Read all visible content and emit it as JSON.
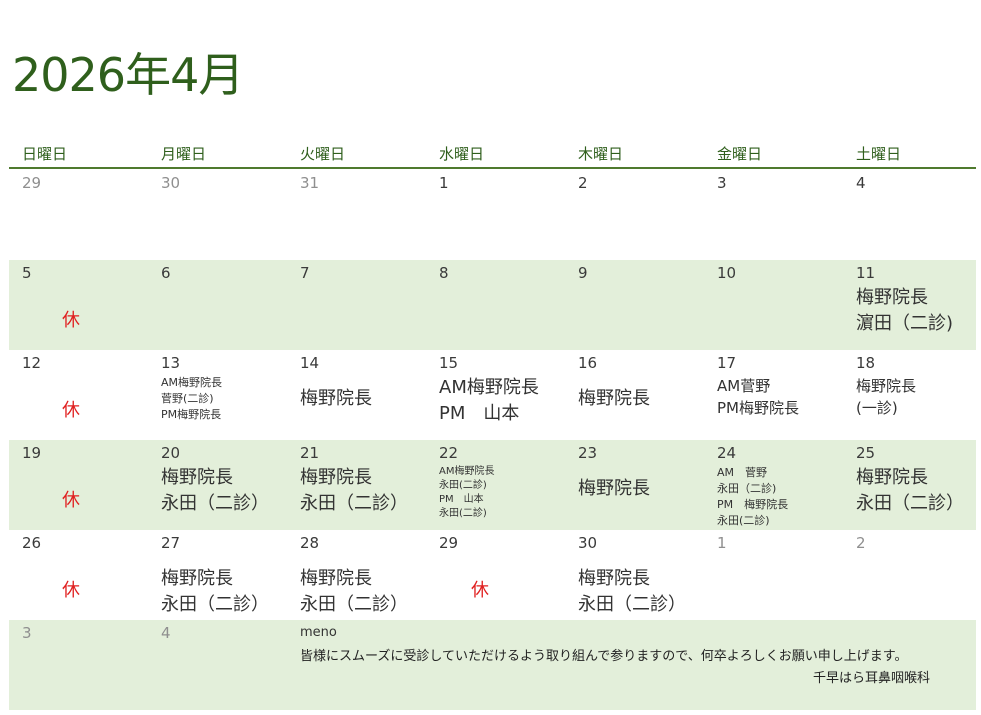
{
  "title": "2026年4月",
  "weekdays": [
    "日曜日",
    "月曜日",
    "火曜日",
    "水曜日",
    "木曜日",
    "金曜日",
    "土曜日"
  ],
  "holiday_mark": "休",
  "weeks": [
    {
      "shaded": false,
      "days": [
        {
          "date": "29",
          "other": true
        },
        {
          "date": "30",
          "other": true
        },
        {
          "date": "31",
          "other": true
        },
        {
          "date": "1"
        },
        {
          "date": "2"
        },
        {
          "date": "3"
        },
        {
          "date": "4"
        }
      ]
    },
    {
      "shaded": true,
      "days": [
        {
          "date": "5",
          "closed": true
        },
        {
          "date": "6"
        },
        {
          "date": "7"
        },
        {
          "date": "8"
        },
        {
          "date": "9"
        },
        {
          "date": "10"
        },
        {
          "date": "11",
          "size": "lg",
          "lines": [
            "梅野院長",
            "濵田（二診)"
          ]
        }
      ]
    },
    {
      "shaded": false,
      "days": [
        {
          "date": "12",
          "closed": true
        },
        {
          "date": "13",
          "size": "sm",
          "lines": [
            "AM梅野院長",
            "菅野(二診)",
            "PM梅野院長"
          ]
        },
        {
          "date": "14",
          "size": "lg",
          "mid": true,
          "lines": [
            "梅野院長"
          ]
        },
        {
          "date": "15",
          "size": "lg",
          "lines": [
            "AM梅野院長",
            "PM　山本"
          ]
        },
        {
          "date": "16",
          "size": "lg",
          "mid": true,
          "lines": [
            "梅野院長"
          ]
        },
        {
          "date": "17",
          "size": "md",
          "lines": [
            "AM菅野",
            "PM梅野院長"
          ]
        },
        {
          "date": "18",
          "size": "md",
          "lines": [
            "梅野院長",
            "(一診)"
          ]
        }
      ]
    },
    {
      "shaded": true,
      "days": [
        {
          "date": "19",
          "closed": true
        },
        {
          "date": "20",
          "size": "lg",
          "lines": [
            "梅野院長",
            "永田（二診）"
          ]
        },
        {
          "date": "21",
          "size": "lg",
          "lines": [
            "梅野院長",
            "永田（二診）"
          ]
        },
        {
          "date": "22",
          "size": "xs",
          "lines": [
            "AM梅野院長",
            "永田(二診)",
            "PM　山本",
            "永田(二診)"
          ]
        },
        {
          "date": "23",
          "size": "lg",
          "mid": true,
          "lines": [
            "梅野院長"
          ]
        },
        {
          "date": "24",
          "size": "sm",
          "lines": [
            "AM　菅野",
            "永田（二診)",
            "PM　梅野院長",
            "永田(二診)"
          ]
        },
        {
          "date": "25",
          "size": "lg",
          "lines": [
            "梅野院長",
            "永田（二診）"
          ]
        }
      ]
    },
    {
      "shaded": false,
      "days": [
        {
          "date": "26",
          "closed": true
        },
        {
          "date": "27",
          "size": "lg",
          "mid": true,
          "lines": [
            "梅野院長",
            "永田（二診）"
          ]
        },
        {
          "date": "28",
          "size": "lg",
          "mid": true,
          "lines": [
            "梅野院長",
            "永田（二診）"
          ]
        },
        {
          "date": "29",
          "closed": true
        },
        {
          "date": "30",
          "size": "lg",
          "mid": true,
          "lines": [
            "梅野院長",
            "永田（二診）"
          ]
        },
        {
          "date": "1",
          "other": true
        },
        {
          "date": "2",
          "other": true
        }
      ]
    }
  ],
  "last_week": {
    "days": [
      {
        "date": "3",
        "other": true
      },
      {
        "date": "4",
        "other": true
      }
    ],
    "memo": {
      "label": "meno",
      "body": "皆様にスムーズに受診していただけるよう取り組んで参りますので、何卒よろしくお願い申し上げます。",
      "signature": "千早はら耳鼻咽喉科"
    }
  }
}
